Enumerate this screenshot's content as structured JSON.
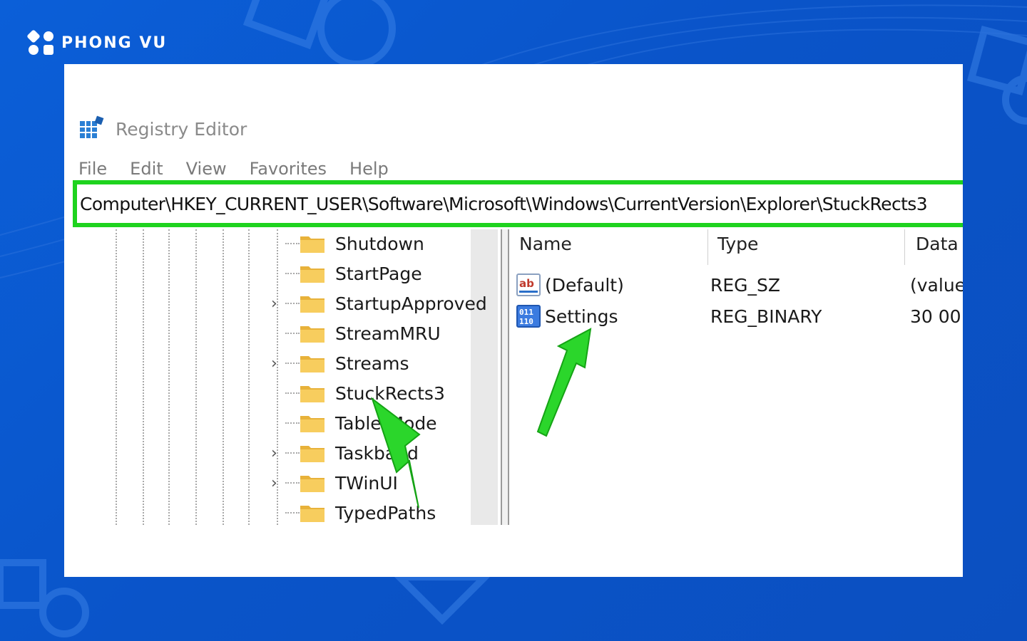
{
  "brand": {
    "name": "PHONG VU"
  },
  "window": {
    "title": "Registry Editor",
    "icon": "registry-editor-icon"
  },
  "menu": [
    "File",
    "Edit",
    "View",
    "Favorites",
    "Help"
  ],
  "address": {
    "path": "Computer\\HKEY_CURRENT_USER\\Software\\Microsoft\\Windows\\CurrentVersion\\Explorer\\StuckRects3",
    "highlight_color": "#1ed31e"
  },
  "tree": {
    "items": [
      {
        "label": "Shutdown",
        "expandable": false,
        "selected": false
      },
      {
        "label": "StartPage",
        "expandable": false,
        "selected": false
      },
      {
        "label": "StartupApproved",
        "expandable": true,
        "selected": false
      },
      {
        "label": "StreamMRU",
        "expandable": false,
        "selected": false
      },
      {
        "label": "Streams",
        "expandable": true,
        "selected": false
      },
      {
        "label": "StuckRects3",
        "expandable": false,
        "selected": true
      },
      {
        "label": "TabletMode",
        "expandable": false,
        "selected": false
      },
      {
        "label": "Taskband",
        "expandable": true,
        "selected": false
      },
      {
        "label": "TWinUI",
        "expandable": true,
        "selected": false
      },
      {
        "label": "TypedPaths",
        "expandable": false,
        "selected": false
      }
    ]
  },
  "values": {
    "columns": {
      "name": "Name",
      "type": "Type",
      "data": "Data"
    },
    "rows": [
      {
        "name": "(Default)",
        "type": "REG_SZ",
        "data": "(value",
        "icon": "string-value-icon"
      },
      {
        "name": "Settings",
        "type": "REG_BINARY",
        "data": "30 00",
        "icon": "binary-value-icon"
      }
    ]
  },
  "annotation_color": "#2bd62b"
}
